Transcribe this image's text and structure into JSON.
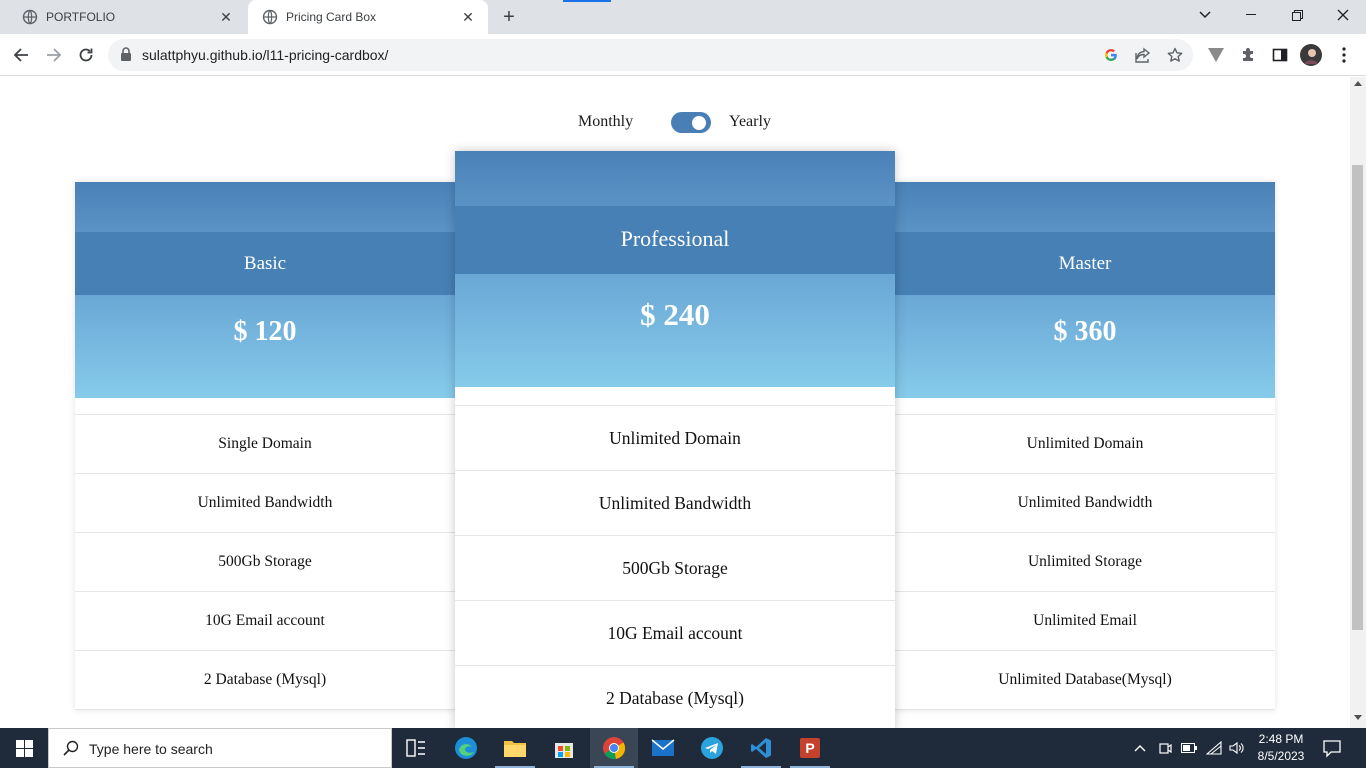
{
  "browser": {
    "tabs": [
      {
        "title": "PORTFOLIO",
        "active": false
      },
      {
        "title": "Pricing Card Box",
        "active": true
      }
    ],
    "url": "sulattphyu.github.io/l11-pricing-cardbox/"
  },
  "billing_toggle": {
    "left_label": "Monthly",
    "right_label": "Yearly",
    "state": "yearly"
  },
  "plans": [
    {
      "name": "Basic",
      "price": "$ 120",
      "features": [
        "Single Domain",
        "Unlimited Bandwidth",
        "500Gb Storage",
        "10G Email account",
        "2 Database (Mysql)"
      ]
    },
    {
      "name": "Professional",
      "price": "$ 240",
      "features": [
        "Unlimited Domain",
        "Unlimited Bandwidth",
        "500Gb Storage",
        "10G Email account",
        "2 Database (Mysql)"
      ]
    },
    {
      "name": "Master",
      "price": "$ 360",
      "features": [
        "Unlimited Domain",
        "Unlimited Bandwidth",
        "Unlimited Storage",
        "Unlimited Email",
        "Unlimited Database(Mysql)"
      ]
    }
  ],
  "colors": {
    "header_dark": "#4680b5",
    "header_top": "#4a82b8",
    "price_gradient_start": "#6aa7d6",
    "price_gradient_end": "#86cbea",
    "toggle": "#4a7fb5"
  },
  "taskbar": {
    "search_placeholder": "Type here to search",
    "time": "2:48 PM",
    "date": "8/5/2023",
    "apps": [
      "task-view",
      "edge",
      "file-explorer",
      "microsoft-store",
      "chrome",
      "mail",
      "telegram",
      "vscode",
      "powerpoint"
    ]
  }
}
